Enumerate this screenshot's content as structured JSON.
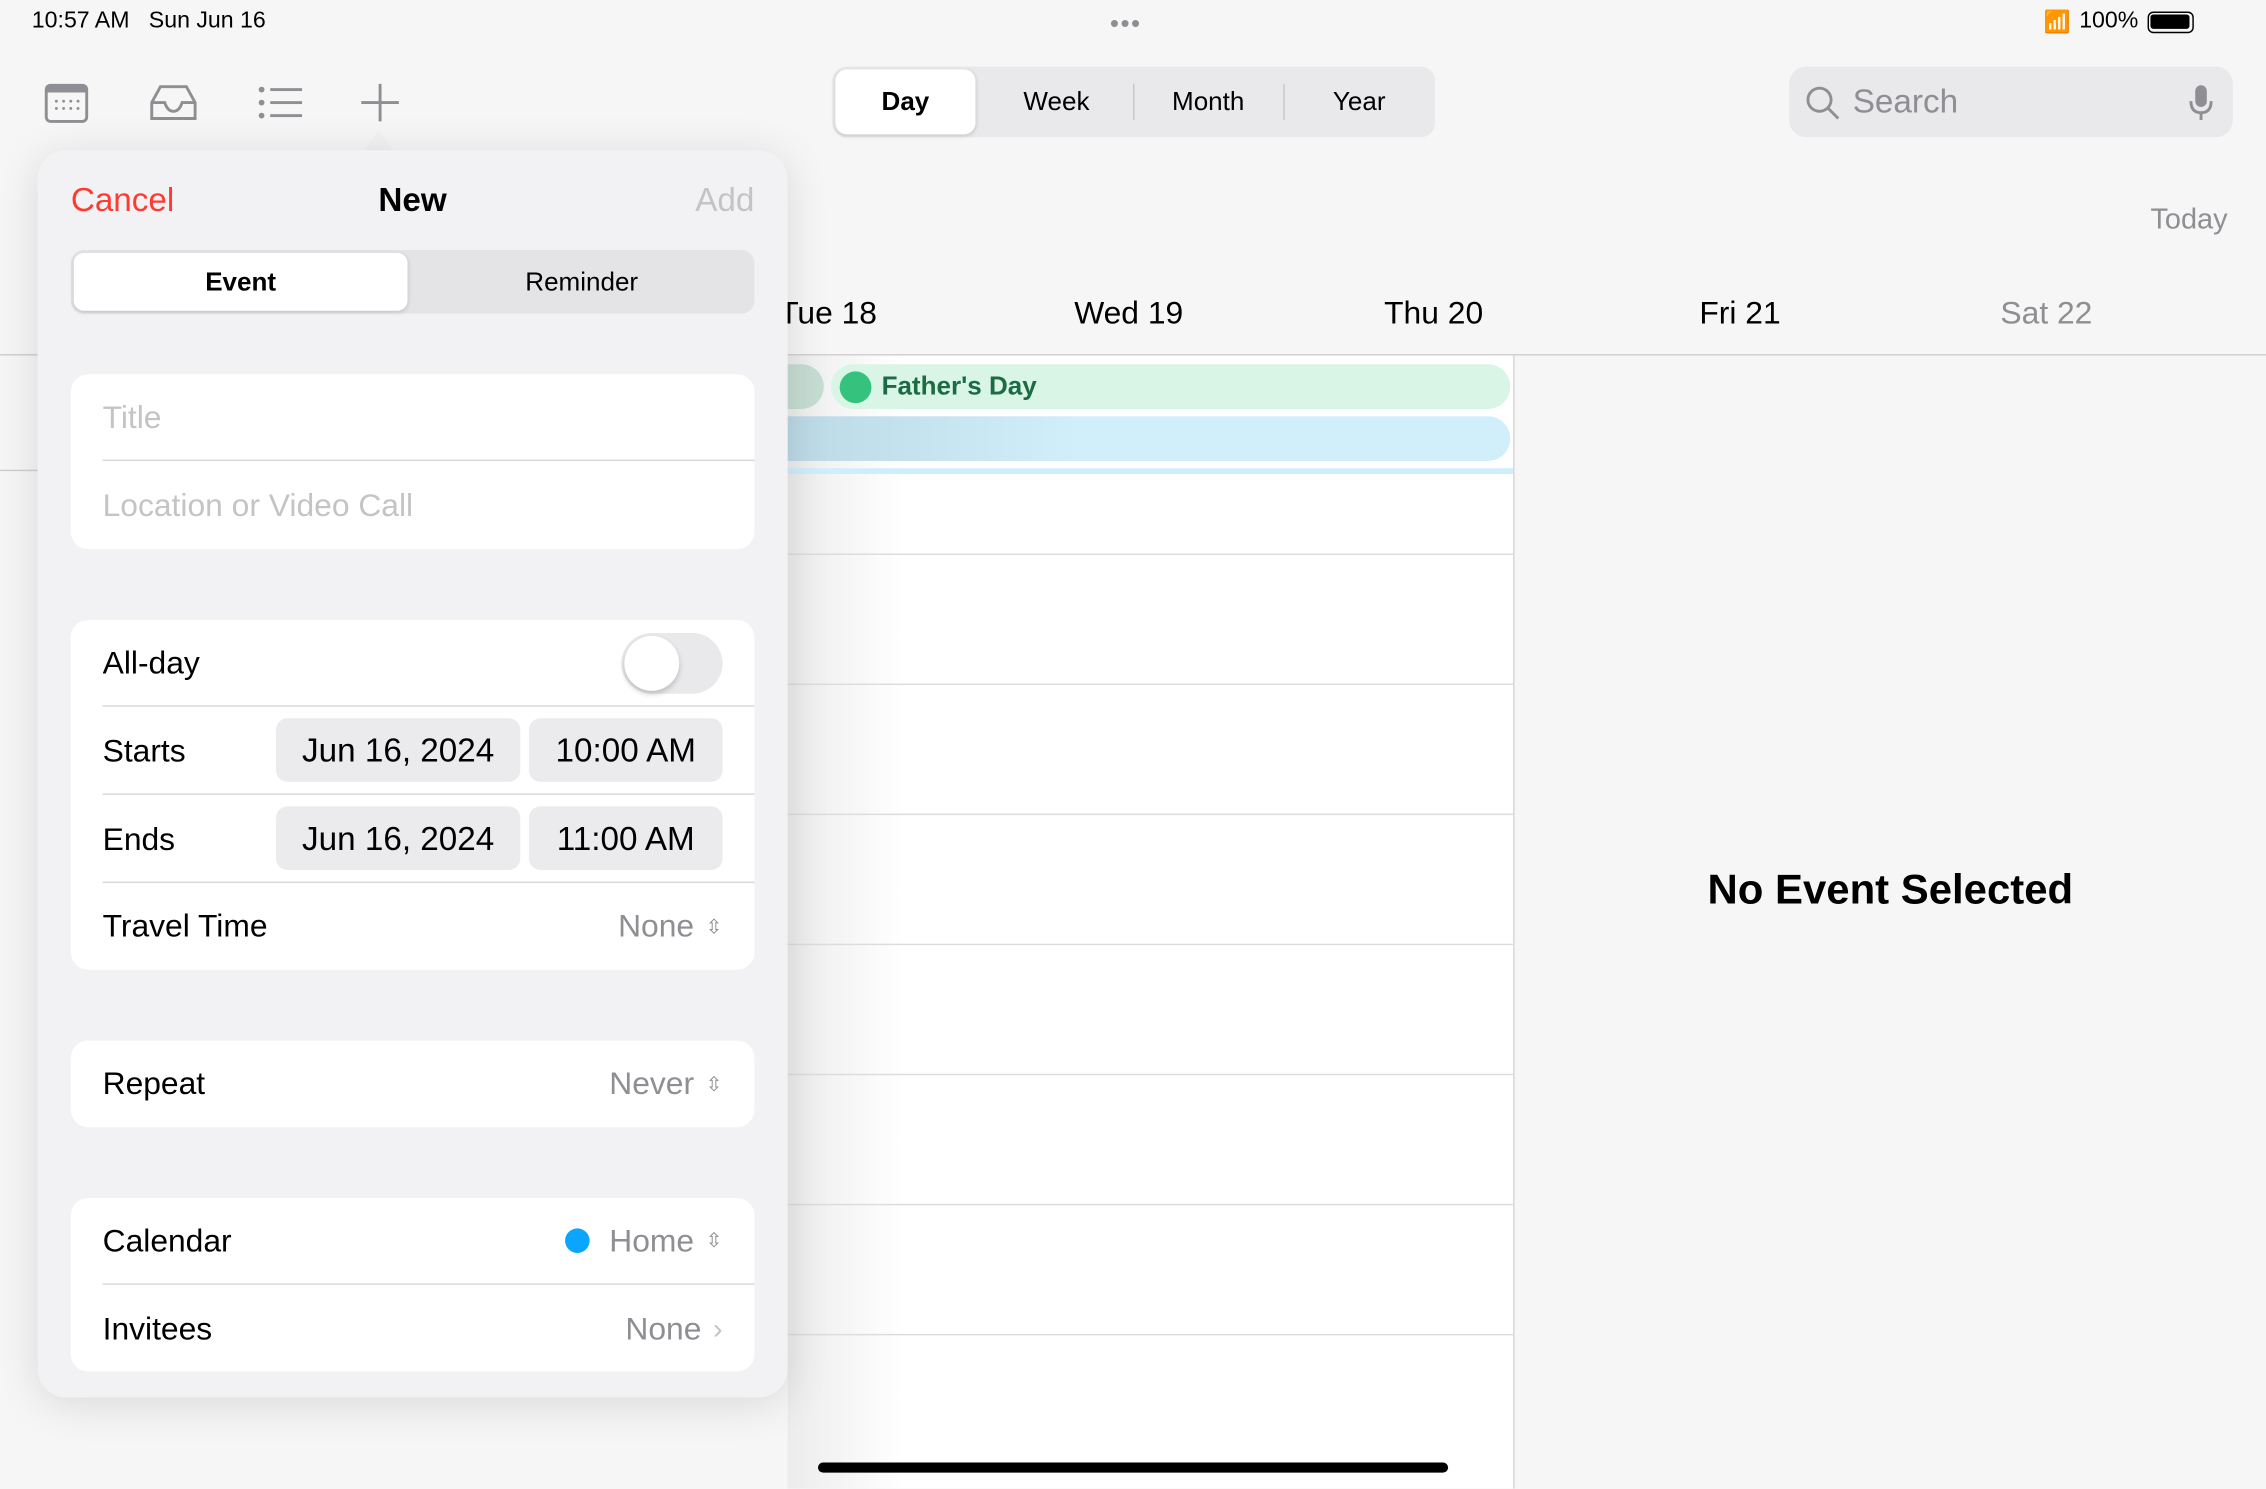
{
  "status": {
    "time": "10:57 AM",
    "date": "Sun Jun 16",
    "battery": "100%"
  },
  "toolbar": {
    "views": [
      "Day",
      "Week",
      "Month",
      "Year"
    ],
    "selected": "Day",
    "search_placeholder": "Search",
    "today": "Today"
  },
  "days": [
    "Tue 18",
    "Wed 19",
    "Thu 20",
    "Fri 21",
    "Sat 22"
  ],
  "events": [
    {
      "title": "Father's Day",
      "color": "#d8f5e6"
    }
  ],
  "detail": {
    "empty": "No Event Selected"
  },
  "popover": {
    "cancel": "Cancel",
    "title": "New",
    "add": "Add",
    "types": [
      "Event",
      "Reminder"
    ],
    "title_placeholder": "Title",
    "location_placeholder": "Location or Video Call",
    "allday": "All-day",
    "allday_on": false,
    "starts": {
      "label": "Starts",
      "date": "Jun 16, 2024",
      "time": "10:00 AM"
    },
    "ends": {
      "label": "Ends",
      "date": "Jun 16, 2024",
      "time": "11:00 AM"
    },
    "travel": {
      "label": "Travel Time",
      "value": "None"
    },
    "repeat": {
      "label": "Repeat",
      "value": "Never"
    },
    "calendar": {
      "label": "Calendar",
      "value": "Home",
      "color": "#0aa5ff"
    },
    "invitees": {
      "label": "Invitees",
      "value": "None"
    }
  },
  "colors": {
    "accent": "#ff3b30"
  }
}
